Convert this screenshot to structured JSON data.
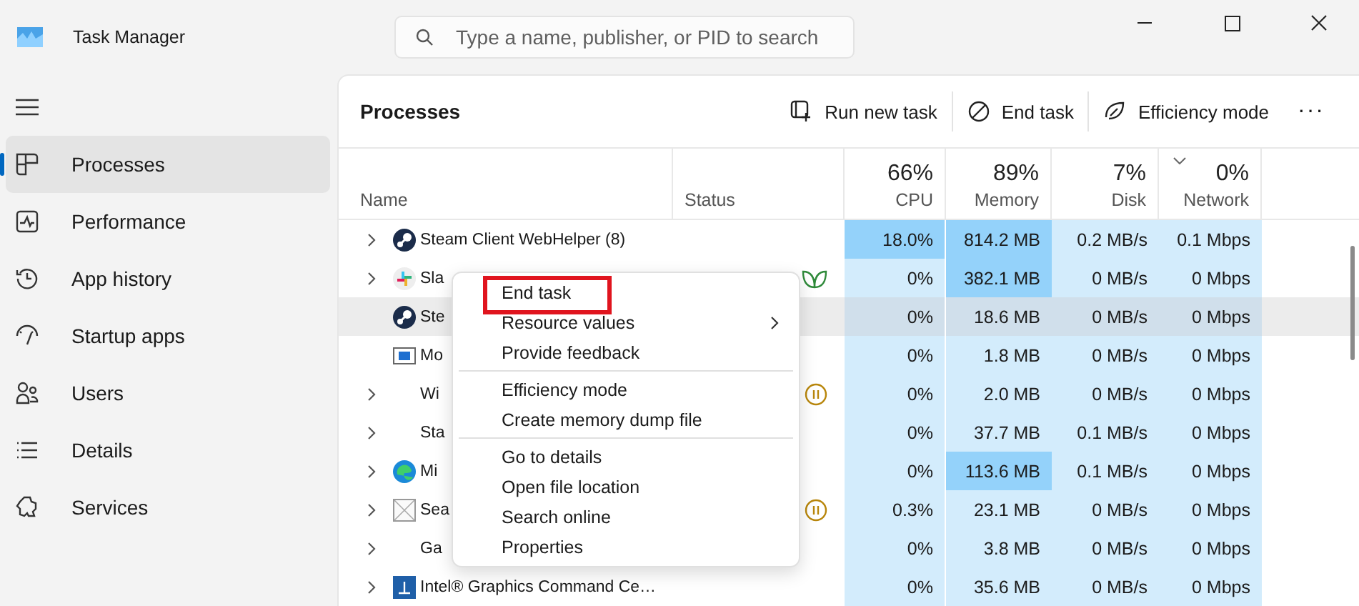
{
  "window": {
    "title": "Task Manager"
  },
  "search": {
    "placeholder": "Type a name, publisher, or PID to search"
  },
  "sidebar": {
    "items": [
      {
        "label": "Processes",
        "kind": "processes",
        "selected": true
      },
      {
        "label": "Performance",
        "kind": "performance",
        "selected": false
      },
      {
        "label": "App history",
        "kind": "history",
        "selected": false
      },
      {
        "label": "Startup apps",
        "kind": "startup",
        "selected": false
      },
      {
        "label": "Users",
        "kind": "users",
        "selected": false
      },
      {
        "label": "Details",
        "kind": "details",
        "selected": false
      },
      {
        "label": "Services",
        "kind": "services",
        "selected": false
      }
    ]
  },
  "page_title": "Processes",
  "toolbar": [
    {
      "label": "Run new task",
      "kind": "run"
    },
    {
      "label": "End task",
      "kind": "end"
    },
    {
      "label": "Efficiency mode",
      "kind": "leaf"
    }
  ],
  "more": "···",
  "table": {
    "name_header": "Name",
    "status_header": "Status",
    "columns": [
      {
        "percent": "66%",
        "label": "CPU",
        "sorted": false
      },
      {
        "percent": "89%",
        "label": "Memory",
        "sorted": false
      },
      {
        "percent": "7%",
        "label": "Disk",
        "sorted": false
      },
      {
        "percent": "0%",
        "label": "Network",
        "sorted": true
      }
    ],
    "rows": [
      {
        "name": "Steam Client WebHelper (8)",
        "kind": "steam",
        "expandable": true,
        "selected": false,
        "cells": [
          {
            "text": "18.0%",
            "high": true
          },
          {
            "text": "814.2 MB",
            "high": true
          },
          {
            "text": "0.2 MB/s",
            "high": false
          },
          {
            "text": "0.1 Mbps",
            "high": false
          }
        ]
      },
      {
        "name": "Sla",
        "kind": "slack",
        "expandable": true,
        "status": {
          "kind": "efficiency"
        },
        "selected": false,
        "cells": [
          {
            "text": "0%",
            "high": false
          },
          {
            "text": "382.1 MB",
            "high": true
          },
          {
            "text": "0 MB/s",
            "high": false
          },
          {
            "text": "0 Mbps",
            "high": false
          }
        ]
      },
      {
        "name": "Ste",
        "kind": "steam",
        "expandable": false,
        "selected": true,
        "cells": [
          {
            "text": "0%",
            "high": false
          },
          {
            "text": "18.6 MB",
            "high": false
          },
          {
            "text": "0 MB/s",
            "high": false
          },
          {
            "text": "0 Mbps",
            "high": false
          }
        ]
      },
      {
        "name": "Mo",
        "kind": "window",
        "expandable": false,
        "selected": false,
        "cells": [
          {
            "text": "0%",
            "high": false
          },
          {
            "text": "1.8 MB",
            "high": false
          },
          {
            "text": "0 MB/s",
            "high": false
          },
          {
            "text": "0 Mbps",
            "high": false
          }
        ]
      },
      {
        "name": "Wi",
        "kind": "none",
        "expandable": true,
        "status": {
          "kind": "suspended"
        },
        "selected": false,
        "cells": [
          {
            "text": "0%",
            "high": false
          },
          {
            "text": "2.0 MB",
            "high": false
          },
          {
            "text": "0 MB/s",
            "high": false
          },
          {
            "text": "0 Mbps",
            "high": false
          }
        ]
      },
      {
        "name": "Sta",
        "kind": "none",
        "expandable": true,
        "selected": false,
        "cells": [
          {
            "text": "0%",
            "high": false
          },
          {
            "text": "37.7 MB",
            "high": false
          },
          {
            "text": "0.1 MB/s",
            "high": false
          },
          {
            "text": "0 Mbps",
            "high": false
          }
        ]
      },
      {
        "name": "Mi",
        "kind": "edge",
        "expandable": true,
        "selected": false,
        "cells": [
          {
            "text": "0%",
            "high": false
          },
          {
            "text": "113.6 MB",
            "high": true
          },
          {
            "text": "0.1 MB/s",
            "high": false
          },
          {
            "text": "0 Mbps",
            "high": false
          }
        ]
      },
      {
        "name": "Sea",
        "kind": "blank",
        "expandable": true,
        "status": {
          "kind": "suspended"
        },
        "selected": false,
        "cells": [
          {
            "text": "0.3%",
            "high": false
          },
          {
            "text": "23.1 MB",
            "high": false
          },
          {
            "text": "0 MB/s",
            "high": false
          },
          {
            "text": "0 Mbps",
            "high": false
          }
        ]
      },
      {
        "name": "Ga",
        "kind": "none",
        "expandable": true,
        "selected": false,
        "cells": [
          {
            "text": "0%",
            "high": false
          },
          {
            "text": "3.8 MB",
            "high": false
          },
          {
            "text": "0 MB/s",
            "high": false
          },
          {
            "text": "0 Mbps",
            "high": false
          }
        ]
      },
      {
        "name": "Intel® Graphics Command Ce…",
        "kind": "intel",
        "expandable": true,
        "selected": false,
        "cells": [
          {
            "text": "0%",
            "high": false
          },
          {
            "text": "35.6 MB",
            "high": false
          },
          {
            "text": "0 MB/s",
            "high": false
          },
          {
            "text": "0 Mbps",
            "high": false
          }
        ]
      }
    ]
  },
  "context_menu": {
    "groups": [
      [
        {
          "label": "End task",
          "submenu": false,
          "highlighted": true
        },
        {
          "label": "Resource values",
          "submenu": true,
          "highlighted": false
        },
        {
          "label": "Provide feedback",
          "submenu": false,
          "highlighted": false
        }
      ],
      [
        {
          "label": "Efficiency mode",
          "submenu": false,
          "highlighted": false
        },
        {
          "label": "Create memory dump file",
          "submenu": false,
          "highlighted": false
        }
      ],
      [
        {
          "label": "Go to details",
          "submenu": false,
          "highlighted": false
        },
        {
          "label": "Open file location",
          "submenu": false,
          "highlighted": false
        },
        {
          "label": "Search online",
          "submenu": false,
          "highlighted": false
        },
        {
          "label": "Properties",
          "submenu": false,
          "highlighted": false
        }
      ]
    ]
  }
}
